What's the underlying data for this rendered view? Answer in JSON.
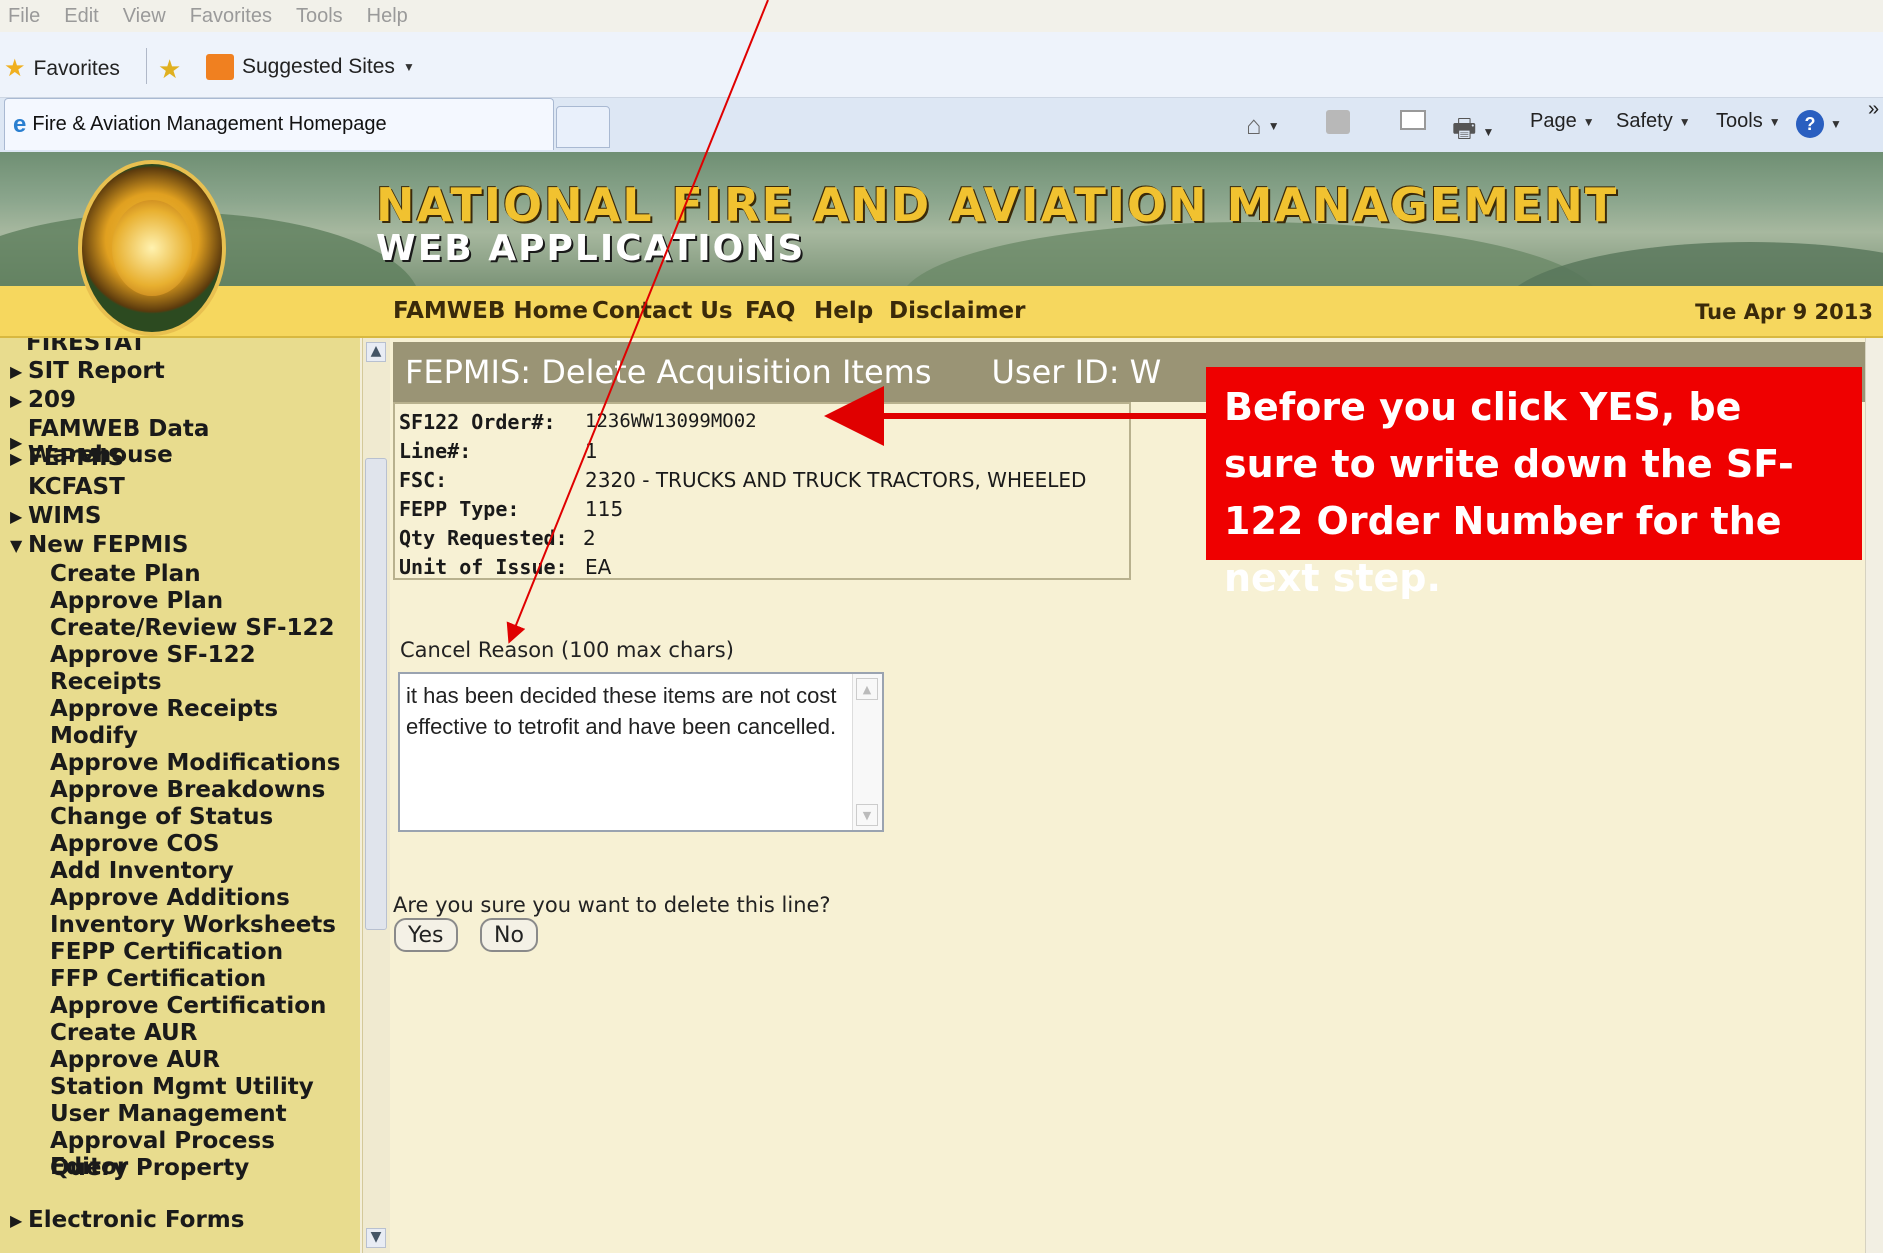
{
  "menubar": [
    "File",
    "Edit",
    "View",
    "Favorites",
    "Tools",
    "Help"
  ],
  "favorites_bar": {
    "favorites": "Favorites",
    "suggested": "Suggested Sites"
  },
  "tab": {
    "title": "Fire & Aviation Management Homepage"
  },
  "command_bar": {
    "page": "Page",
    "safety": "Safety",
    "tools": "Tools",
    "overflow": "»"
  },
  "header": {
    "title1": "NATIONAL FIRE AND AVIATION MANAGEMENT",
    "title2": "WEB APPLICATIONS"
  },
  "nav": {
    "links": [
      "FAMWEB Home",
      "Contact Us",
      "FAQ",
      "Help",
      "Disclaimer"
    ],
    "date": "Tue Apr 9 2013"
  },
  "sidebar": {
    "partial_top": "FIRESTAT",
    "top_items": [
      "SIT Report",
      "209",
      "FAMWEB Data Warehouse",
      "FEPMIS",
      "KCFAST",
      "WIMS",
      "New FEPMIS"
    ],
    "sub_items": [
      "Create Plan",
      "Approve Plan",
      "Create/Review SF-122",
      "Approve SF-122",
      "Receipts",
      "Approve Receipts",
      "Modify",
      "Approve Modifications",
      "Approve Breakdowns",
      "Change of Status",
      "Approve COS",
      "Add Inventory",
      "Approve Additions",
      "Inventory Worksheets",
      "FEPP Certification",
      "FFP Certification",
      "Approve Certification",
      "Create AUR",
      "Approve AUR",
      "Station Mgmt Utility",
      "User Management",
      "Approval Process Editor",
      "Query Property"
    ],
    "bottom_item": "Electronic Forms"
  },
  "page": {
    "title": "FEPMIS: Delete Acquisition Items",
    "user_id": "User ID: W"
  },
  "details": [
    {
      "label": "SF122 Order#:",
      "value": "1236WW13099MO02"
    },
    {
      "label": "Line#:",
      "value": "1"
    },
    {
      "label": "FSC:",
      "value": "2320 - TRUCKS AND TRUCK TRACTORS, WHEELED"
    },
    {
      "label": "FEPP Type:",
      "value": "115"
    },
    {
      "label": "Qty Requested:",
      "value": "2"
    },
    {
      "label": "Unit of Issue:",
      "value": "EA"
    }
  ],
  "cancel": {
    "label": "Cancel Reason (100 max chars)",
    "text": "it has been decided these items are not cost effective to tetrofit and have been cancelled."
  },
  "confirm": {
    "question": "Are you sure you want to delete this line?",
    "yes": "Yes",
    "no": "No"
  },
  "annotation": {
    "text": "Before you click YES, be sure to write down the SF-122 Order Number for the next step.",
    "color": "#ef0000"
  },
  "colors": {
    "banner_gold": "#f1c230",
    "nav_bar": "#f6d75e",
    "sidebar": "#e8dc8e",
    "title_bar": "#9a9475",
    "content": "#f7f1d4"
  }
}
